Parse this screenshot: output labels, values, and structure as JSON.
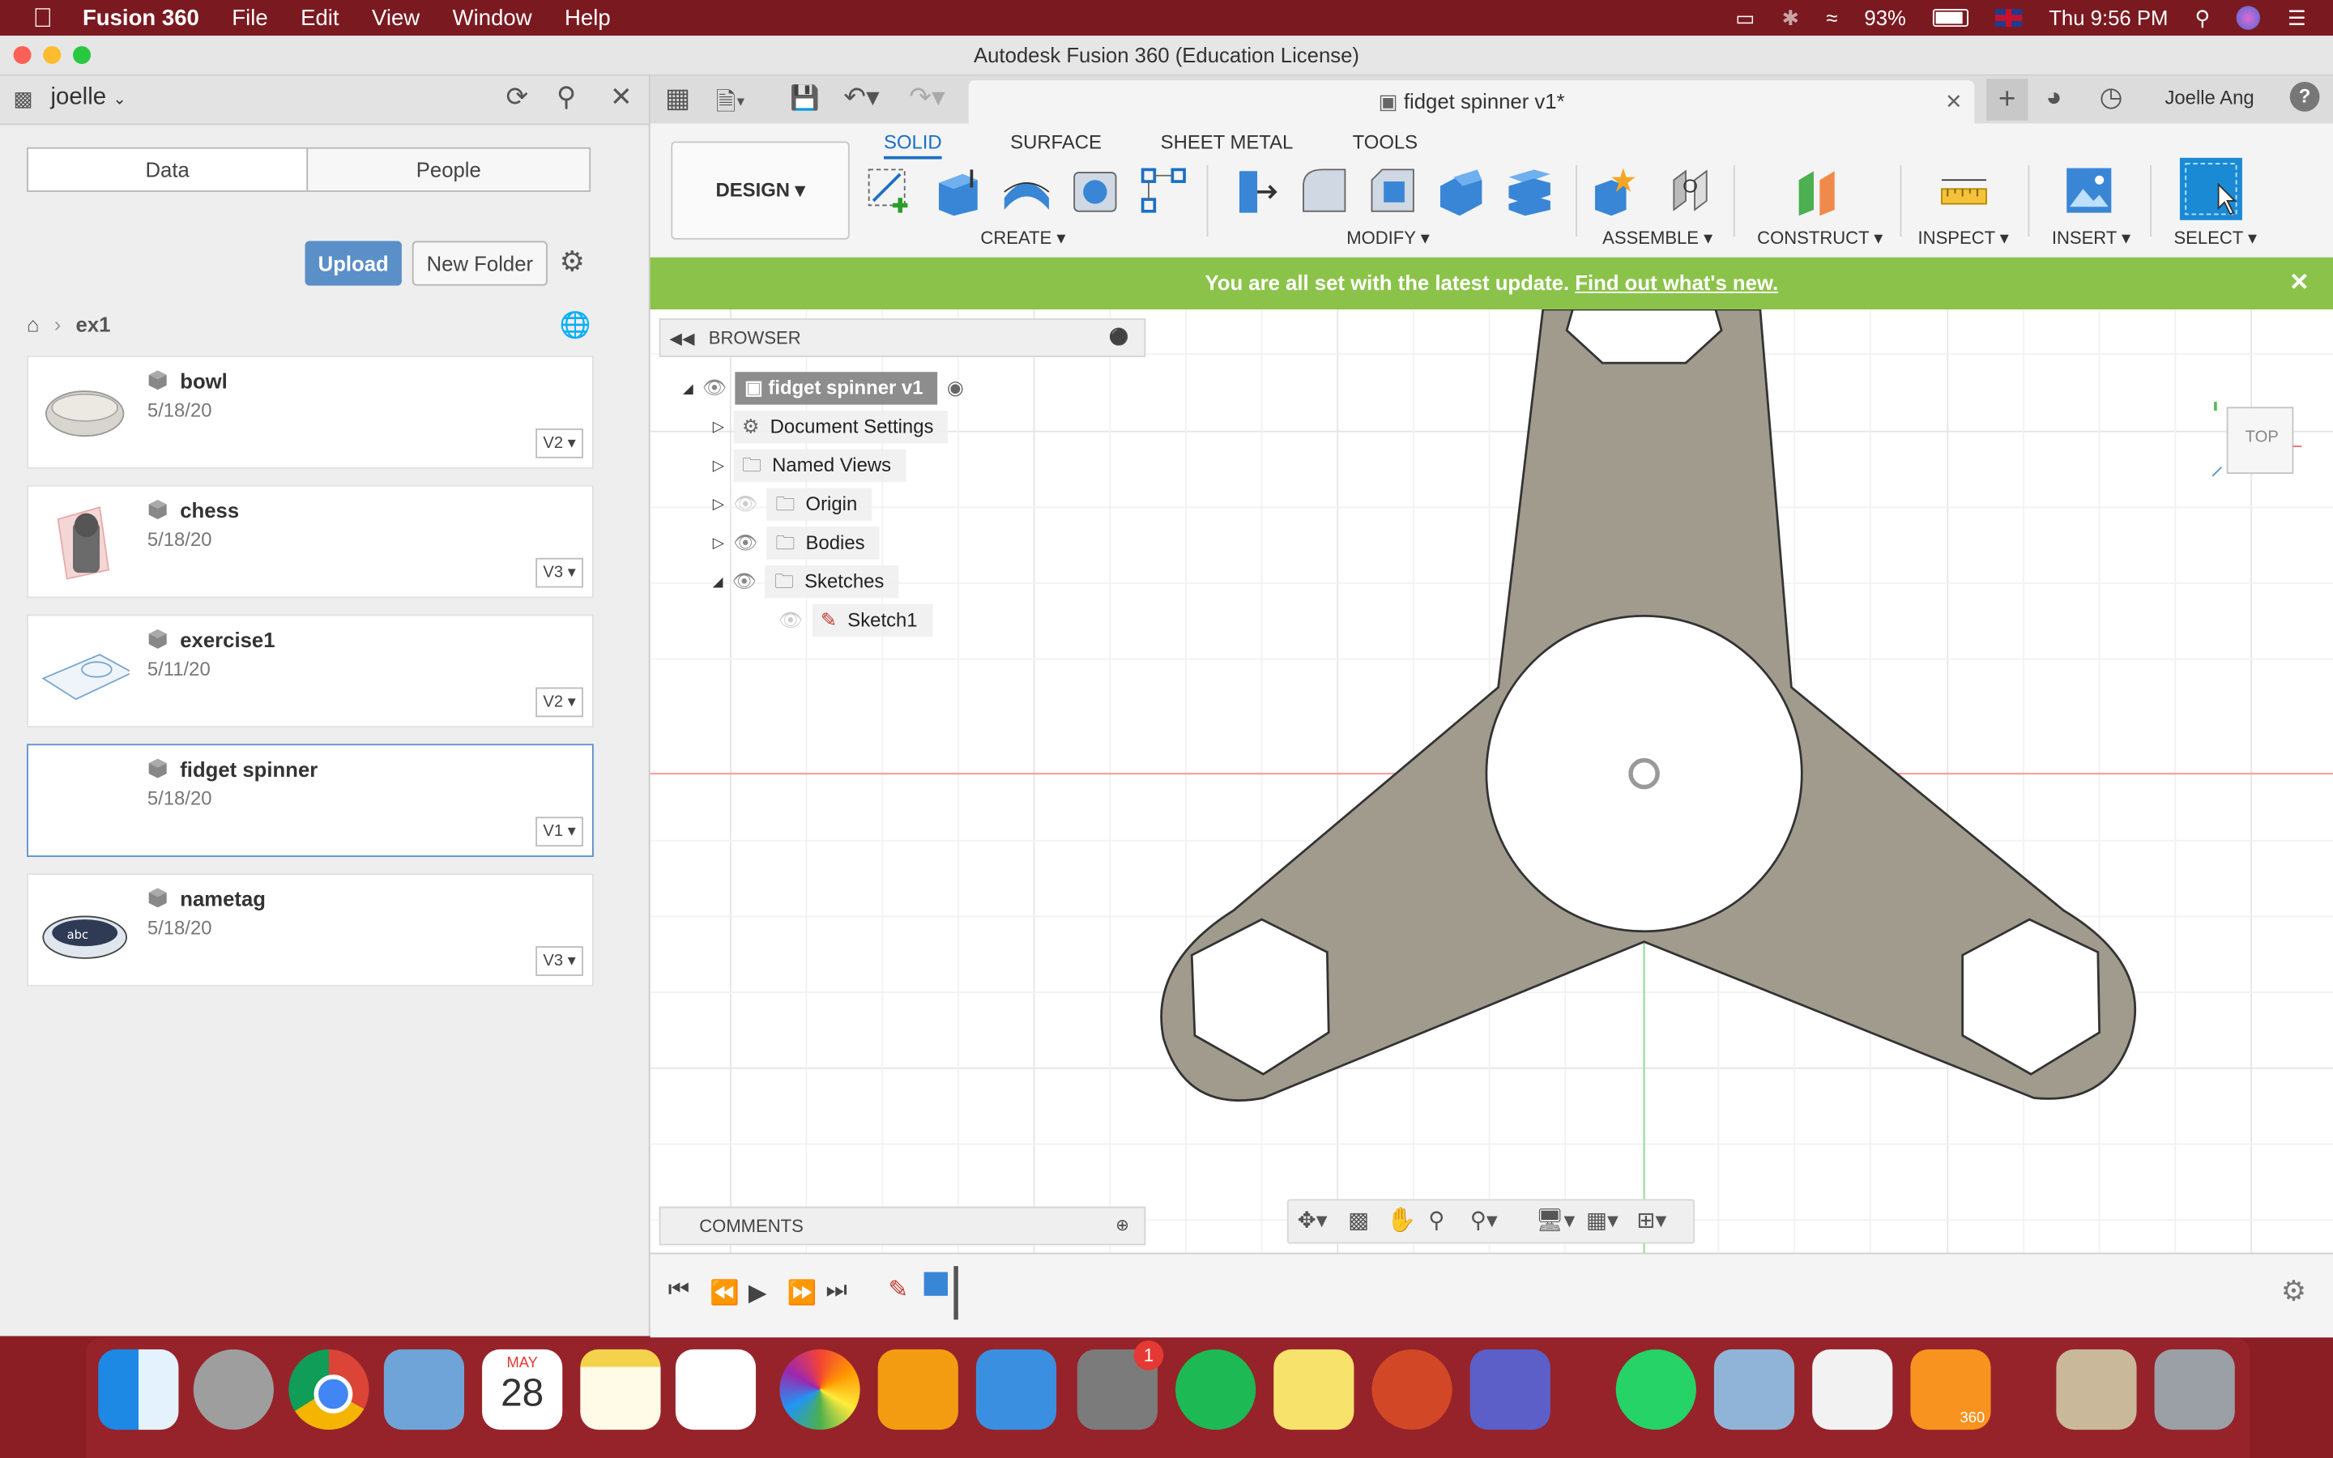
{
  "menubar": {
    "app_name": "Fusion 360",
    "items": [
      "File",
      "Edit",
      "View",
      "Window",
      "Help"
    ],
    "battery": "93%",
    "clock": "Thu 9:56 PM"
  },
  "window": {
    "title": "Autodesk Fusion 360 (Education License)"
  },
  "data_panel": {
    "user": "joelle",
    "tabs": [
      "Data",
      "People"
    ],
    "upload_label": "Upload",
    "new_folder_label": "New Folder",
    "breadcrumb": "ex1",
    "items": [
      {
        "name": "bowl",
        "date": "5/18/20",
        "version": "V2"
      },
      {
        "name": "chess",
        "date": "5/18/20",
        "version": "V3"
      },
      {
        "name": "exercise1",
        "date": "5/11/20",
        "version": "V2"
      },
      {
        "name": "fidget spinner",
        "date": "5/18/20",
        "version": "V1"
      },
      {
        "name": "nametag",
        "date": "5/18/20",
        "version": "V3"
      }
    ]
  },
  "tabstrip": {
    "doc_tab": "fidget spinner v1*",
    "user": "Joelle Ang"
  },
  "toolbar": {
    "workspace": "DESIGN",
    "tabs": [
      "SOLID",
      "SURFACE",
      "SHEET METAL",
      "TOOLS"
    ],
    "groups": [
      "CREATE",
      "MODIFY",
      "ASSEMBLE",
      "CONSTRUCT",
      "INSPECT",
      "INSERT",
      "SELECT"
    ]
  },
  "banner": {
    "text": "You are all set with the latest update.",
    "link": "Find out what's new."
  },
  "browser": {
    "title": "BROWSER",
    "root": "fidget spinner v1",
    "nodes": [
      "Document Settings",
      "Named Views",
      "Origin",
      "Bodies",
      "Sketches",
      "Sketch1"
    ],
    "comments_title": "COMMENTS"
  },
  "viewcube": {
    "face": "TOP"
  },
  "dock": {
    "calendar_month": "MAY",
    "calendar_day": "28",
    "badge": "1",
    "fusion_label": "360"
  },
  "colors": {
    "menubar": "#7a1a20",
    "accent": "#1a6fc4",
    "banner": "#8bc34a",
    "spinner_fill": "#a09b8c",
    "upload": "#5b8fc8"
  }
}
